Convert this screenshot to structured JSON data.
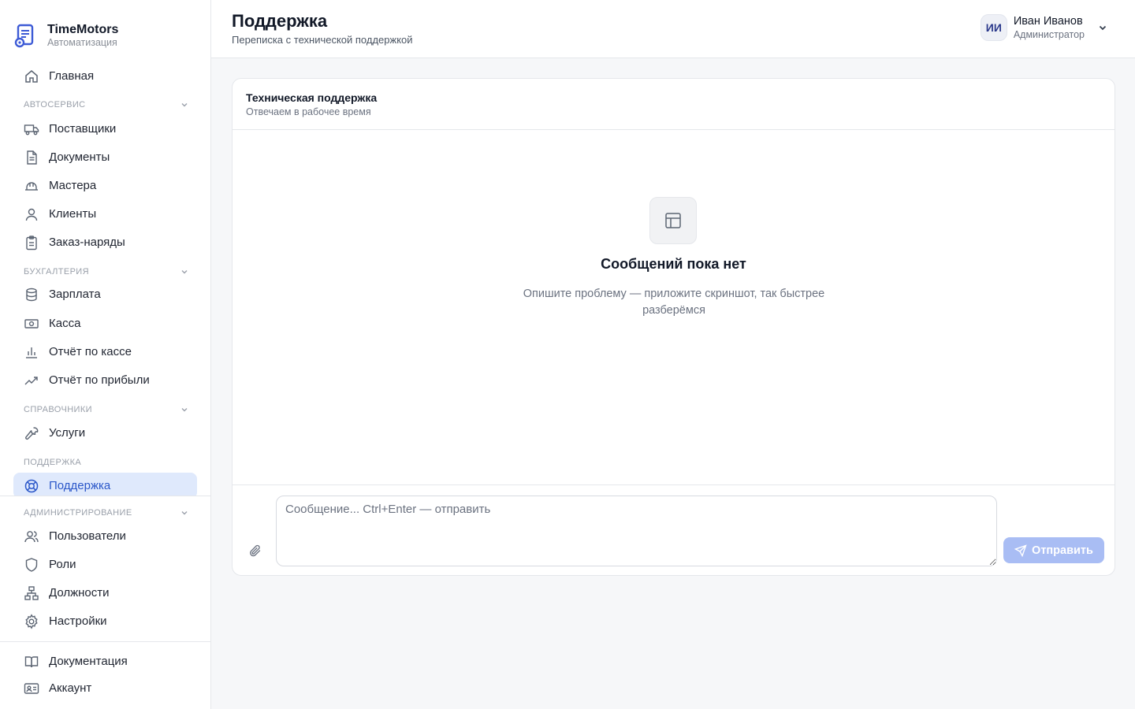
{
  "brand": {
    "name": "TimeMotors",
    "subtitle": "Автоматизация"
  },
  "header": {
    "title": "Поддержка",
    "subtitle": "Переписка с технической поддержкой",
    "user": {
      "initials": "ИИ",
      "name": "Иван Иванов",
      "role": "Администратор"
    }
  },
  "sidebar": {
    "home": "Главная",
    "sections": [
      {
        "label": "АВТОСЕРВИС",
        "items": [
          "Поставщики",
          "Документы",
          "Мастера",
          "Клиенты",
          "Заказ-наряды"
        ]
      },
      {
        "label": "БУХГАЛТЕРИЯ",
        "items": [
          "Зарплата",
          "Касса",
          "Отчёт по кассе",
          "Отчёт по прибыли"
        ]
      },
      {
        "label": "СПРАВОЧНИКИ",
        "items": [
          "Услуги"
        ]
      },
      {
        "label": "ПОДДЕРЖКА",
        "items": [
          "Поддержка"
        ]
      },
      {
        "label": "АДМИНИСТРИРОВАНИЕ",
        "items": [
          "Пользователи",
          "Роли",
          "Должности",
          "Настройки"
        ]
      }
    ],
    "active": "Поддержка",
    "footer": [
      "Документация",
      "Аккаунт"
    ]
  },
  "chat": {
    "title": "Техническая поддержка",
    "subtitle": "Отвечаем в рабочее время",
    "empty_title": "Сообщений пока нет",
    "empty_desc": "Опишите проблему — приложите скриншот, так быстрее разберёмся",
    "input_placeholder": "Сообщение... Ctrl+Enter — отправить",
    "input_value": "",
    "send_label": "Отправить"
  },
  "colors": {
    "accent": "#2b57c9",
    "active_bg": "#dfe9fc",
    "send_disabled": "#a9bdf4"
  }
}
